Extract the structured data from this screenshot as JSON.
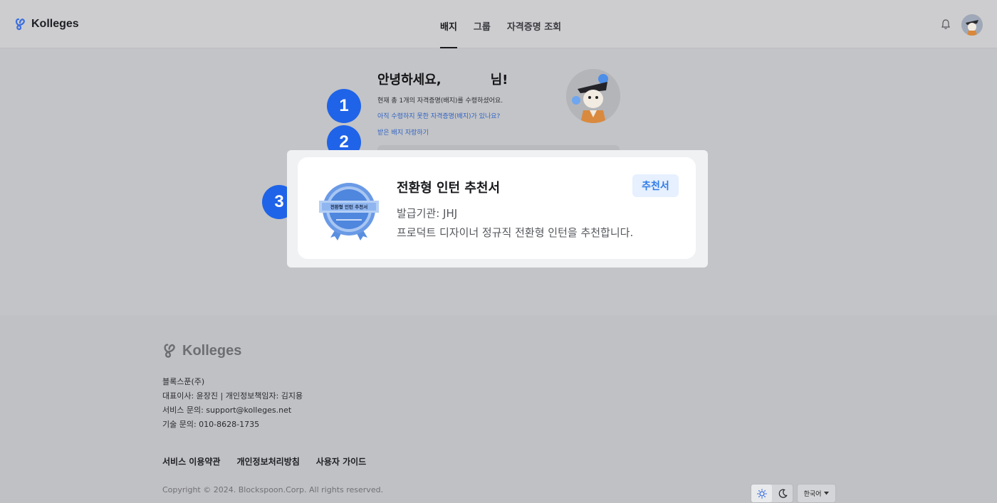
{
  "header": {
    "logo_text": "Kolleges",
    "nav": [
      {
        "label": "배지",
        "active": true
      },
      {
        "label": "그룹",
        "active": false
      },
      {
        "label": "자격증명 조회",
        "active": false
      }
    ]
  },
  "greeting": {
    "title": "안녕하세요,           님!",
    "summary": "현재 총 1개의 자격증명(배지)를 수령하셨어요.",
    "unclaimed_link": "아직 수령하지 못한 자격증명(배지)가 있나요?",
    "share_link": "받은 배지 자랑하기"
  },
  "steps": [
    "1",
    "2",
    "3"
  ],
  "badge_card": {
    "badge_ribbon_text": "전환형 인턴 추천서",
    "title": "전환형 인턴 추천서",
    "issuer": "발급기관: JHJ",
    "description": "프로덕트 디자이너 정규직 전환형 인턴을 추천합니다.",
    "tag": "추천서"
  },
  "footer": {
    "logo_text": "Kolleges",
    "company": "블록스푼(주)",
    "representative": "대표이사: 윤장진 | 개인정보책임자: 김지용",
    "service_contact": "서비스 문의: support@kolleges.net",
    "tech_contact": "기술 문의: 010-8628-1735",
    "links": [
      "서비스 이용약관",
      "개인정보처리방침",
      "사용자 가이드"
    ],
    "copyright": "Copyright © 2024. Blockspoon.Corp. All rights reserved.",
    "language": "한국어"
  },
  "colors": {
    "accent_blue": "#1f63e8",
    "link_blue": "#2f63c4",
    "tag_bg": "#e6f0fe",
    "tag_text": "#2f7be8"
  },
  "icons": [
    "logo-icon",
    "bell-icon",
    "sun-icon",
    "moon-icon",
    "caret-down-icon"
  ]
}
